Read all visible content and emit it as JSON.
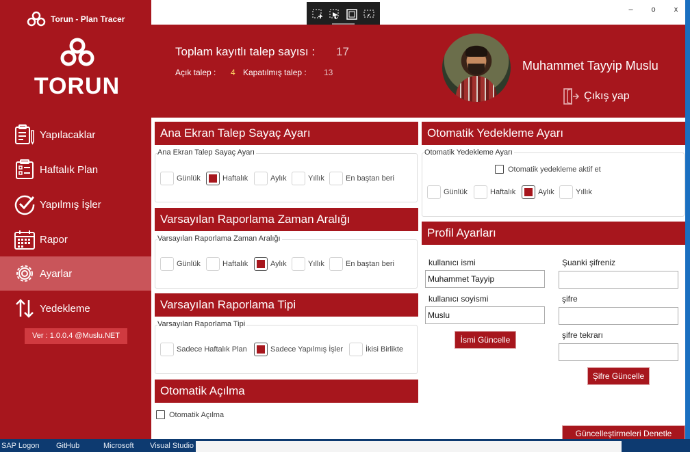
{
  "app": {
    "title": "Torun - Plan Tracer",
    "brand": "TORUN",
    "version": "Ver : 1.0.0.4 @Muslu.NET"
  },
  "window_controls": {
    "minimize": "–",
    "maximize": "o",
    "close": "x"
  },
  "sidebar": {
    "items": [
      {
        "label": "Yapılacaklar",
        "icon": "clipboard-pen-icon"
      },
      {
        "label": "Haftalık Plan",
        "icon": "checklist-icon"
      },
      {
        "label": "Yapılmış İşler",
        "icon": "check-circle-icon"
      },
      {
        "label": "Rapor",
        "icon": "calendar-icon"
      },
      {
        "label": "Ayarlar",
        "icon": "gear-icon",
        "active": true
      },
      {
        "label": "Yedekleme",
        "icon": "up-down-arrows-icon"
      }
    ]
  },
  "header": {
    "total_label": "Toplam kayıtlı talep sayısı :",
    "total_value": "17",
    "open_label": "Açık talep :",
    "open_value": "4",
    "closed_label": "Kapatılmış talep :",
    "closed_value": "13",
    "user_name": "Muhammet Tayyip Muslu",
    "logout_label": "Çıkış yap"
  },
  "sections": {
    "counter": {
      "title": "Ana Ekran Talep Sayaç Ayarı",
      "group_label": "Ana Ekran Talep Sayaç Ayarı",
      "options": [
        {
          "label": "Günlük",
          "checked": false
        },
        {
          "label": "Haftalık",
          "checked": true
        },
        {
          "label": "Aylık",
          "checked": false
        },
        {
          "label": "Yıllık",
          "checked": false
        },
        {
          "label": "En baştan beri",
          "checked": false
        }
      ]
    },
    "report_range": {
      "title": "Varsayılan Raporlama Zaman Aralığı",
      "group_label": "Varsayılan Raporlama Zaman Aralığı",
      "options": [
        {
          "label": "Günlük",
          "checked": false
        },
        {
          "label": "Haftalık",
          "checked": false
        },
        {
          "label": "Aylık",
          "checked": true
        },
        {
          "label": "Yıllık",
          "checked": false
        },
        {
          "label": "En baştan beri",
          "checked": false
        }
      ]
    },
    "report_type": {
      "title": "Varsayılan Raporlama Tipi",
      "group_label": "Varsayılan Raporlama Tipi",
      "options": [
        {
          "label": "Sadece Haftalık Plan",
          "checked": false
        },
        {
          "label": "Sadece Yapılmış İşler",
          "checked": true
        },
        {
          "label": "İkisi Birlikte",
          "checked": false
        }
      ]
    },
    "auto_open": {
      "title": "Otomatik Açılma",
      "checkbox_label": "Otomatik Açılma",
      "checked": false
    },
    "backup": {
      "title": "Otomatik Yedekleme Ayarı",
      "group_label": "Otomatik Yedekleme Ayarı",
      "active_label": "Otomatik yedekleme aktif et",
      "active_checked": false,
      "options": [
        {
          "label": "Günlük",
          "checked": false
        },
        {
          "label": "Haftalık",
          "checked": false
        },
        {
          "label": "Aylık",
          "checked": true
        },
        {
          "label": "Yıllık",
          "checked": false
        }
      ]
    },
    "profile": {
      "title": "Profil Ayarları",
      "first_name_label": "kullanıcı ismi",
      "first_name_value": "Muhammet Tayyip",
      "last_name_label": "kullanıcı soyismi",
      "last_name_value": "Muslu",
      "update_name_button": "İsmi Güncelle",
      "current_password_label": "Şuanki şifreniz",
      "password_label": "şifre",
      "password_repeat_label": "şifre tekrarı",
      "update_password_button": "Şifre Güncelle",
      "check_updates_button": "Güncelleştirmeleri Denetle"
    }
  },
  "taskbar": {
    "items": [
      "SAP Logon",
      "GitHub",
      "Microsoft",
      "Visual Studio"
    ]
  },
  "colors": {
    "accent": "#a7161d",
    "highlight": "#ffd766",
    "active_nav": "#c9555a"
  }
}
